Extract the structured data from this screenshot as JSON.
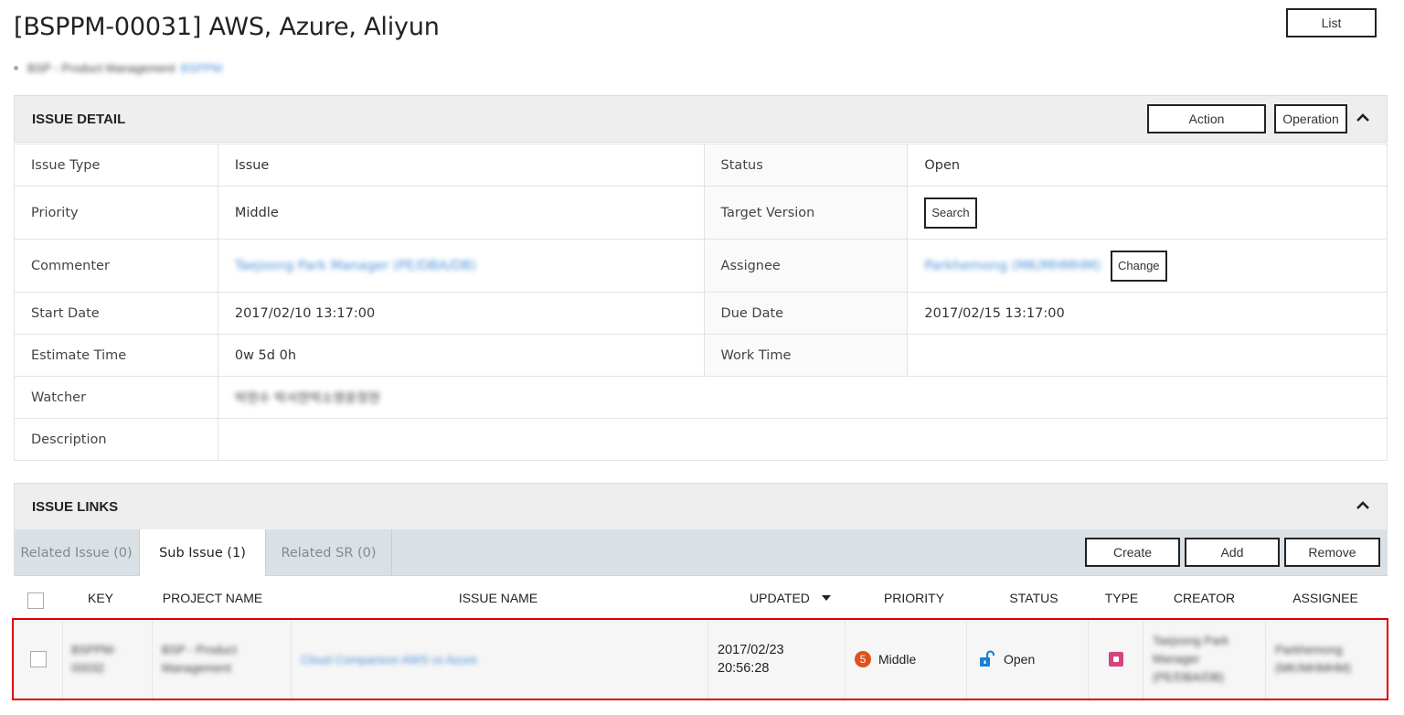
{
  "page": {
    "title": "[BSPPM-00031] AWS, Azure, Aliyun",
    "list_button": "List",
    "breadcrumb_project": "BSP - Product Management",
    "breadcrumb_key": "BSPPM"
  },
  "issue_detail": {
    "section_title": "ISSUE DETAIL",
    "action_button": "Action",
    "operation_button": "Operation",
    "fields": {
      "issue_type_label": "Issue Type",
      "issue_type_value": "Issue",
      "status_label": "Status",
      "status_value": "Open",
      "priority_label": "Priority",
      "priority_value": "Middle",
      "target_version_label": "Target Version",
      "search_button": "Search",
      "commenter_label": "Commenter",
      "commenter_value": "Taejoong Park Manager (PE/DBA/DB)",
      "assignee_label": "Assignee",
      "assignee_value": "Parkhemong (MK/MHMHM)",
      "change_button": "Change",
      "start_date_label": "Start Date",
      "start_date_value": "2017/02/10 13:17:00",
      "due_date_label": "Due Date",
      "due_date_value": "2017/02/15 13:17:00",
      "estimate_time_label": "Estimate Time",
      "estimate_time_value": "0w 5d 0h",
      "work_time_label": "Work Time",
      "watcher_label": "Watcher",
      "watcher_value": "박현수 박서현박소영윤정현",
      "description_label": "Description"
    }
  },
  "issue_links": {
    "section_title": "ISSUE LINKS",
    "tabs": [
      {
        "label": "Related Issue (0)"
      },
      {
        "label": "Sub Issue (1)"
      },
      {
        "label": "Related SR (0)"
      }
    ],
    "create_button": "Create",
    "add_button": "Add",
    "remove_button": "Remove",
    "columns": {
      "key": "KEY",
      "project_name": "PROJECT NAME",
      "issue_name": "ISSUE NAME",
      "updated": "UPDATED",
      "priority": "PRIORITY",
      "status": "STATUS",
      "type": "TYPE",
      "creator": "CREATOR",
      "assignee": "ASSIGNEE"
    },
    "rows": [
      {
        "key": "BSPPM-00032",
        "project_name": "BSP - Product Management",
        "issue_name": "Cloud Comparison AWS vs Azure",
        "updated_date": "2017/02/23",
        "updated_time": "20:56:28",
        "priority_num": "5",
        "priority": "Middle",
        "status": "Open",
        "creator": "Taejoong Park Manager (PE/DBA/DB)",
        "assignee": "Parkhemong (MK/MHMHM)"
      }
    ]
  },
  "colors": {
    "highlight_border": "#e00000",
    "priority_badge": "#e0521a",
    "type_icon": "#d4457f",
    "status_icon": "#1a7fd4",
    "link": "#4a90d9"
  }
}
